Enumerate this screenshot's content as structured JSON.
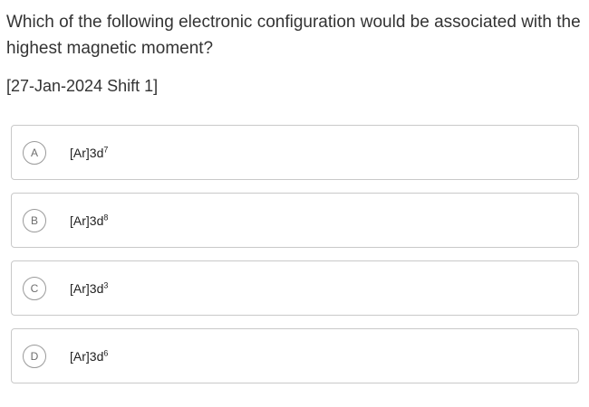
{
  "question": {
    "text": "Which of the following electronic configuration would be associated with the highest magnetic moment?",
    "exam_tag": "[27-Jan-2024 Shift 1]"
  },
  "options": [
    {
      "letter": "A",
      "base": "[Ar]3d",
      "superscript": "7"
    },
    {
      "letter": "B",
      "base": "[Ar]3d",
      "superscript": "8"
    },
    {
      "letter": "C",
      "base": "[Ar]3d",
      "superscript": "3"
    },
    {
      "letter": "D",
      "base": "[Ar]3d",
      "superscript": "6"
    }
  ]
}
